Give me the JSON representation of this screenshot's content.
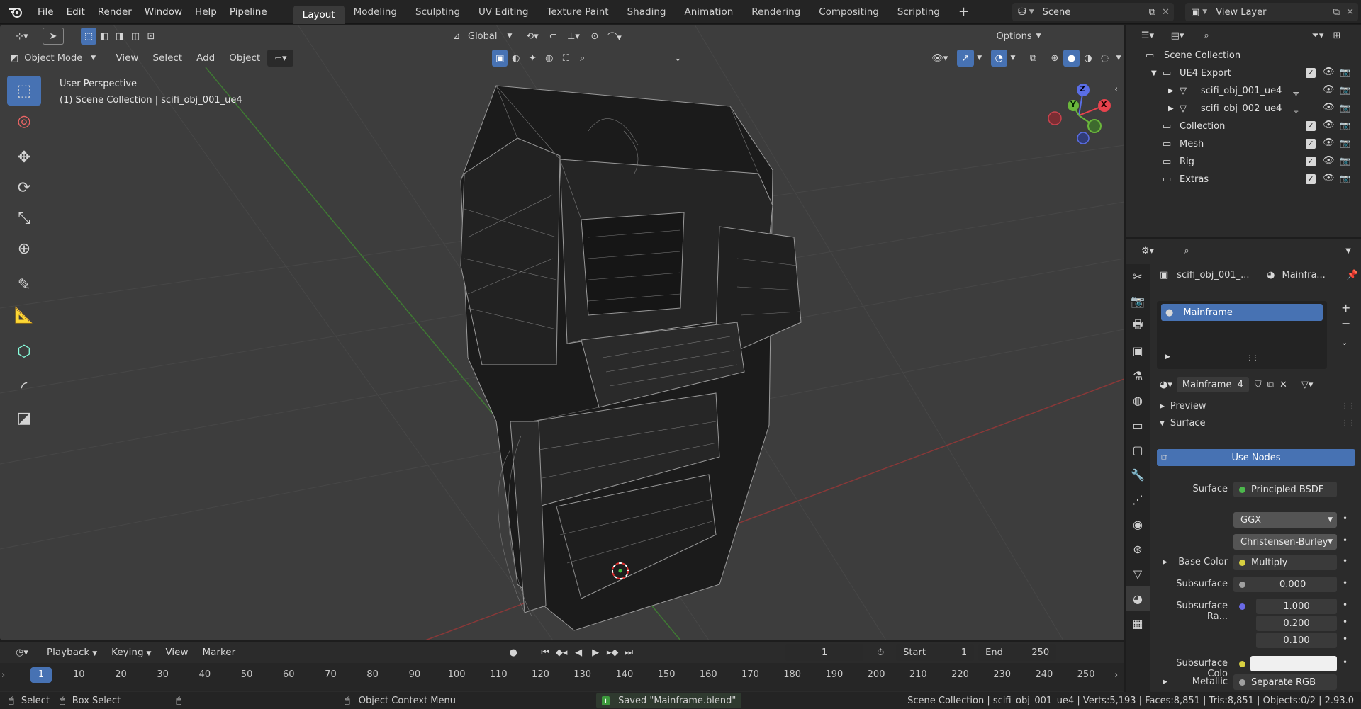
{
  "topbar": {
    "menus": [
      "File",
      "Edit",
      "Render",
      "Window",
      "Help",
      "Pipeline"
    ],
    "workspaces": [
      "Layout",
      "Modeling",
      "Sculpting",
      "UV Editing",
      "Texture Paint",
      "Shading",
      "Animation",
      "Rendering",
      "Compositing",
      "Scripting"
    ],
    "active_workspace": "Layout",
    "add_tab": "+",
    "scene": "Scene",
    "view_layer": "View Layer"
  },
  "viewport": {
    "orientation": "Global",
    "options": "Options",
    "mode": "Object Mode",
    "menus": [
      "View",
      "Select",
      "Add",
      "Object"
    ],
    "overlay_line1": "User Perspective",
    "overlay_line2": "(1) Scene Collection | scifi_obj_001_ue4",
    "gizmo": {
      "x": "X",
      "y": "Y",
      "z": "Z"
    }
  },
  "timeline": {
    "menus": [
      "Playback",
      "Keying",
      "View",
      "Marker"
    ],
    "current_frame": "1",
    "start_label": "Start",
    "start": "1",
    "end_label": "End",
    "end": "250",
    "ruler": [
      "1",
      "10",
      "20",
      "30",
      "40",
      "50",
      "60",
      "70",
      "80",
      "90",
      "100",
      "110",
      "120",
      "130",
      "140",
      "150",
      "160",
      "170",
      "180",
      "190",
      "200",
      "210",
      "220",
      "230",
      "240",
      "250"
    ]
  },
  "statusbar": {
    "select": "Select",
    "box_select": "Box Select",
    "context_menu": "Object Context Menu",
    "message": "Saved \"Mainframe.blend\"",
    "stats": "Scene Collection | scifi_obj_001_ue4 | Verts:5,193 | Faces:8,851 | Tris:8,851 | Objects:0/2 | 2.93.0"
  },
  "outliner": {
    "root": "Scene Collection",
    "items": [
      {
        "label": "UE4 Export"
      },
      {
        "label": "scifi_obj_001_ue4"
      },
      {
        "label": "scifi_obj_002_ue4"
      },
      {
        "label": "Collection"
      },
      {
        "label": "Mesh"
      },
      {
        "label": "Rig"
      },
      {
        "label": "Extras"
      }
    ]
  },
  "properties": {
    "object_name": "scifi_obj_001_...",
    "material_short": "Mainfra...",
    "slot": "Mainframe",
    "material_name": "Mainframe",
    "users": "4",
    "sections": {
      "preview": "Preview",
      "surface": "Surface"
    },
    "use_nodes": "Use Nodes",
    "surface_label": "Surface",
    "surface_value": "Principled BSDF",
    "distribution": "GGX",
    "subsurface_method": "Christensen-Burley",
    "base_color_label": "Base Color",
    "base_color_value": "Multiply",
    "subsurface_label": "Subsurface",
    "subsurface_value": "0.000",
    "subsurface_radius_label": "Subsurface Ra...",
    "subsurface_radius": [
      "1.000",
      "0.200",
      "0.100"
    ],
    "subsurface_color_label": "Subsurface Colo",
    "metallic_label": "Metallic",
    "metallic_value": "Separate RGB"
  },
  "colors": {
    "accent": "#4772b3",
    "x_axis": "#e8424d",
    "y_axis": "#6ab63b",
    "z_axis": "#5a6ee6"
  }
}
